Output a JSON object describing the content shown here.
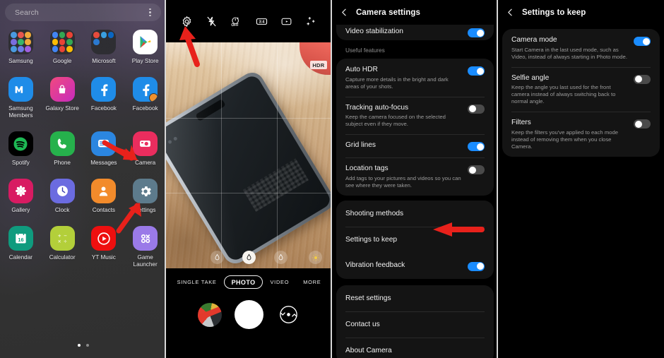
{
  "panels": [
    {
      "name": "app-drawer"
    },
    {
      "name": "camera-viewfinder"
    },
    {
      "name": "camera-settings"
    },
    {
      "name": "settings-to-keep"
    }
  ],
  "drawer": {
    "search": {
      "placeholder": "Search",
      "value": "",
      "menu_icon": "kebab-menu-icon"
    },
    "page_indicator": {
      "total": 2,
      "current": 1
    },
    "apps": [
      {
        "label": "Samsung",
        "icon": "folder-icon",
        "type": "folder",
        "colors": [
          "#4a9ae0",
          "#e5574e",
          "#f0a93b",
          "#7a6ee0",
          "#39b56a",
          "#f0a93b",
          "#4a9ae0",
          "#6f7ce6",
          "#a05fe0"
        ]
      },
      {
        "label": "Google",
        "icon": "folder-icon",
        "type": "folder",
        "colors": [
          "#4285f4",
          "#34a853",
          "#ea4335",
          "#fbbc05",
          "#ea4335",
          "#34a853",
          "#4285f4",
          "#ea4335",
          "#fbbc05"
        ]
      },
      {
        "label": "Microsoft",
        "icon": "folder-icon",
        "type": "folder",
        "colors": [
          "#e74b3c",
          "#3aa0e0",
          "#0a66c2",
          "#2b79d0",
          "#2e2e33",
          "#2e2e33",
          "#2e2e33",
          "#2e2e33",
          "#2e2e33"
        ]
      },
      {
        "label": "Play Store",
        "icon": "play-store-icon",
        "type": "app",
        "colors": [
          "#ffffff"
        ]
      },
      {
        "label": "Samsung Members",
        "icon": "samsung-members-icon",
        "type": "app",
        "colors": [
          "#1f8ce8"
        ]
      },
      {
        "label": "Galaxy Store",
        "icon": "galaxy-store-icon",
        "type": "app",
        "colors": [
          "#e0379a"
        ]
      },
      {
        "label": "Facebook",
        "icon": "facebook-icon",
        "type": "app",
        "colors": [
          "#1f8ce8"
        ]
      },
      {
        "label": "Facebook",
        "icon": "facebook-lite-icon",
        "type": "app",
        "colors": [
          "#1f8ce8"
        ]
      },
      {
        "label": "Spotify",
        "icon": "spotify-icon",
        "type": "app",
        "colors": [
          "#000000",
          "#1db954"
        ]
      },
      {
        "label": "Phone",
        "icon": "phone-icon",
        "type": "app",
        "colors": [
          "#26b14c"
        ]
      },
      {
        "label": "Messages",
        "icon": "messages-icon",
        "type": "app",
        "colors": [
          "#2b86e0"
        ]
      },
      {
        "label": "Camera",
        "icon": "camera-icon",
        "type": "app",
        "colors": [
          "#ea2d5e"
        ]
      },
      {
        "label": "Gallery",
        "icon": "gallery-icon",
        "type": "app",
        "colors": [
          "#d81b62"
        ]
      },
      {
        "label": "Clock",
        "icon": "clock-icon",
        "type": "app",
        "colors": [
          "#6b6be0"
        ]
      },
      {
        "label": "Contacts",
        "icon": "contacts-icon",
        "type": "app",
        "colors": [
          "#f28b2b"
        ]
      },
      {
        "label": "Settings",
        "icon": "settings-gear-icon",
        "type": "app",
        "colors": [
          "#5d7b8c"
        ]
      },
      {
        "label": "Calendar",
        "icon": "calendar-icon",
        "type": "app",
        "colors": [
          "#0f9b7e"
        ],
        "day": "16"
      },
      {
        "label": "Calculator",
        "icon": "calculator-icon",
        "type": "app",
        "colors": [
          "#b3cf3a"
        ]
      },
      {
        "label": "YT Music",
        "icon": "yt-music-icon",
        "type": "app",
        "colors": [
          "#ee0f0f"
        ]
      },
      {
        "label": "Game Launcher",
        "icon": "game-launcher-icon",
        "type": "app",
        "colors": [
          "#9a7ae8"
        ]
      }
    ]
  },
  "camera": {
    "top_bar": [
      {
        "icon": "settings-gear-icon",
        "label": "Camera settings"
      },
      {
        "icon": "flash-off-icon",
        "label": "Flash off"
      },
      {
        "icon": "timer-off-icon",
        "label": "OFF"
      },
      {
        "icon": "aspect-ratio-icon",
        "label": "3:4"
      },
      {
        "icon": "motion-photo-icon",
        "label": "Motion photo"
      },
      {
        "icon": "filters-icon",
        "label": "Filters"
      }
    ],
    "hdr_badge": "HDR",
    "filter_buttons": [
      {
        "icon": "bokeh-low-icon",
        "selected": false
      },
      {
        "icon": "bokeh-mid-icon",
        "selected": true
      },
      {
        "icon": "bokeh-high-icon",
        "selected": false
      }
    ],
    "brightness_button": {
      "icon": "sun-icon"
    },
    "modes": [
      {
        "label": "SINGLE TAKE",
        "selected": false
      },
      {
        "label": "PHOTO",
        "selected": true
      },
      {
        "label": "VIDEO",
        "selected": false
      },
      {
        "label": "MORE",
        "selected": false
      }
    ],
    "gallery_thumb": {
      "icon": "gallery-thumbnail"
    },
    "shutter": {
      "icon": "shutter-button"
    },
    "flip": {
      "icon": "flip-camera-icon"
    }
  },
  "camera_settings": {
    "header": {
      "title": "Camera settings",
      "back_icon": "back-chevron-icon"
    },
    "partial_top_row": {
      "title": "Video stabilization",
      "toggle": "on"
    },
    "section_title": "Useful features",
    "rows": [
      {
        "title": "Auto HDR",
        "sub": "Capture more details in the bright and dark areas of your shots.",
        "toggle": "on"
      },
      {
        "title": "Tracking auto-focus",
        "sub": "Keep the camera focused on the selected subject even if they move.",
        "toggle": "off"
      },
      {
        "title": "Grid lines",
        "sub": "",
        "toggle": "on"
      },
      {
        "title": "Location tags",
        "sub": "Add tags to your pictures and videos so you can see where they were taken.",
        "toggle": "off"
      }
    ],
    "plain_rows": [
      {
        "title": "Shooting methods"
      },
      {
        "title": "Settings to keep"
      }
    ],
    "vibration_row": {
      "title": "Vibration feedback",
      "toggle": "on"
    },
    "footer_rows": [
      {
        "title": "Reset settings"
      },
      {
        "title": "Contact us"
      },
      {
        "title": "About Camera"
      }
    ]
  },
  "settings_to_keep": {
    "header": {
      "title": "Settings to keep",
      "back_icon": "back-chevron-icon"
    },
    "rows": [
      {
        "title": "Camera mode",
        "sub": "Start Camera in the last used mode, such as Video, instead of always starting in Photo mode.",
        "toggle": "on"
      },
      {
        "title": "Selfie angle",
        "sub": "Keep the angle you last used for the front camera instead of always switching back to normal angle.",
        "toggle": "off"
      },
      {
        "title": "Filters",
        "sub": "Keep the filters you've applied to each mode instead of removing them when you close Camera.",
        "toggle": "off"
      }
    ]
  },
  "annotations": {
    "arrow_color": "#e8211b",
    "arrows": [
      {
        "name": "arrow-to-camera-settings-gear",
        "panel": "camera-viewfinder"
      },
      {
        "name": "arrow-to-camera-app-upper",
        "panel": "app-drawer"
      },
      {
        "name": "arrow-to-camera-app-lower",
        "panel": "app-drawer"
      },
      {
        "name": "arrow-to-settings-to-keep",
        "panel": "camera-settings"
      }
    ]
  }
}
